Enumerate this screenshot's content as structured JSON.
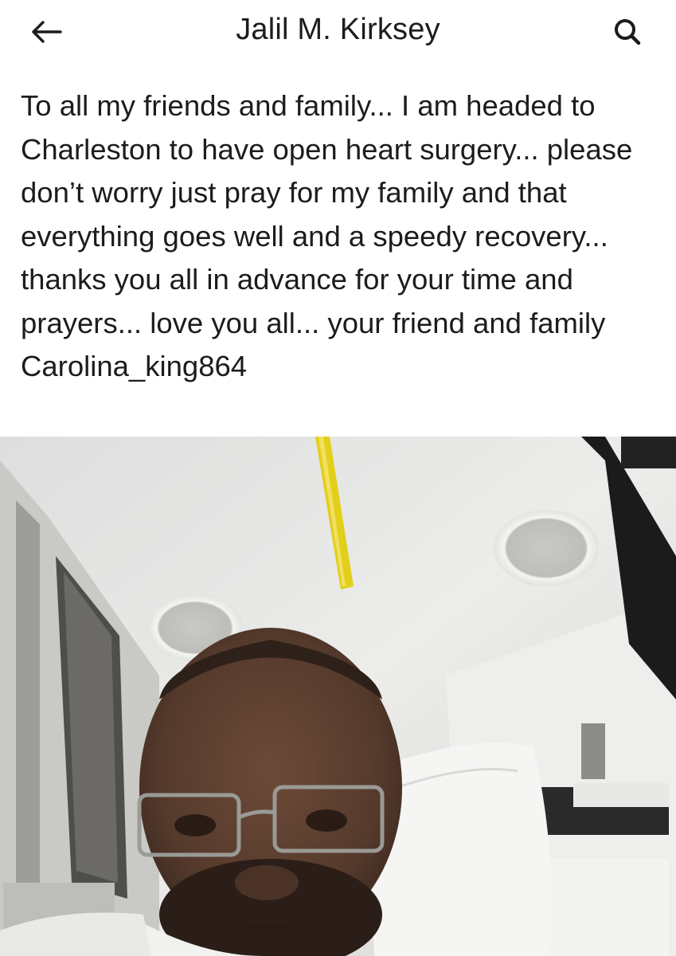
{
  "header": {
    "title": "Jalil M. Kirksey",
    "back_icon": "arrow-left-icon",
    "search_icon": "search-icon"
  },
  "post": {
    "text": "To all my friends and family... I am headed to Charleston to have open heart surgery... please don’t worry just pray for my family and that everything goes well and a speedy recovery... thanks you all in advance for your time and prayers... love you all... your friend and family Carolina_king864"
  },
  "photo": {
    "subject": "selfie-in-ambulance",
    "colors": {
      "ceiling": "#e8e8e6",
      "grab_bar": "#e2cf1a",
      "skin": "#5a3e30"
    }
  }
}
